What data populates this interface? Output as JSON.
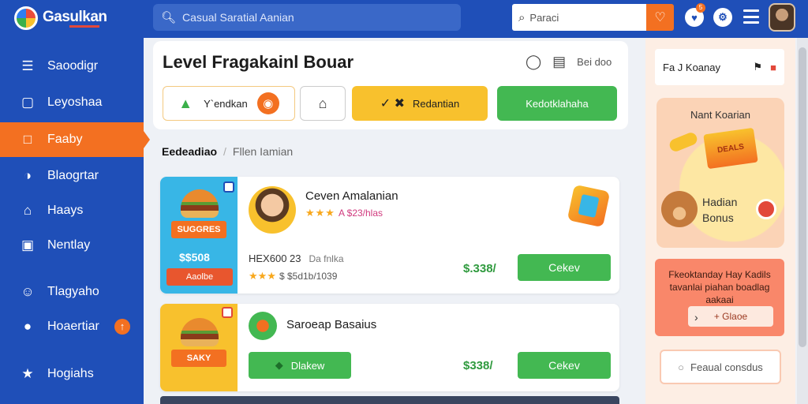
{
  "app": {
    "brand": "Gasulkan",
    "logo_icon": "app-logo-icon"
  },
  "topbar": {
    "search_placeholder": "Casual Saratial Aanian",
    "search2_placeholder": "Paraci",
    "notif_count": "5"
  },
  "sidebar": {
    "items": [
      {
        "label": "Saoodigr",
        "icon": "list-icon"
      },
      {
        "label": "Leyoshaa",
        "icon": "window-icon"
      },
      {
        "label": "Faaby",
        "icon": "document-icon",
        "active": true
      },
      {
        "label": "Blaogrtar",
        "icon": "chat-icon"
      },
      {
        "label": "Haays",
        "icon": "home-icon"
      },
      {
        "label": "Nentlay",
        "icon": "page-icon"
      },
      {
        "label": "Tlagyaho",
        "icon": "user-icon"
      },
      {
        "label": "Hoaertiar",
        "icon": "message-icon"
      },
      {
        "label": "Hogiahs",
        "icon": "star-icon"
      }
    ],
    "badge": "↑"
  },
  "header": {
    "title": "Level Fragakainl Bouar",
    "action_text": "Bei doo",
    "chips": {
      "vendor": "Y`endkan",
      "promo": "Redantian",
      "green": "Kedotklahaha"
    }
  },
  "breadcrumb": {
    "parent": "Eedeadiao",
    "current": "Fllen Iamian"
  },
  "products": [
    {
      "name": "Ceven Amalanian",
      "rating_text": "A $23/hlas",
      "sku": "HEX600 23",
      "sku_note": "Da fnlka",
      "rating2_text": "$ $5d1b/1039",
      "thumb_title": "SUGGRES",
      "thumb_price": "$$508",
      "thumb_button": "Aaolbe",
      "price": "$.338/",
      "buy_label": "Cekev"
    },
    {
      "name": "Saroeap Basaius",
      "thumb_title": "SAKY",
      "order_label": "Dlakew",
      "price": "$338/",
      "buy_label": "Cekev"
    }
  ],
  "right_panel": {
    "top_label": "Fa J Koanay",
    "bonus_title": "Nant Koarian",
    "bonus_flag": "DEALS",
    "bonus_name": "Hadian\nBonus",
    "promo_text": "Fkeoktanday Hay Kadils tavanlai piahan boadlag aakaai",
    "promo_button": "Glaoe",
    "feed_button": "Feaual consdus"
  },
  "colors": {
    "primary": "#1f4fb8",
    "accent": "#f37021",
    "green": "#43b852",
    "yellow": "#f8c12d"
  }
}
